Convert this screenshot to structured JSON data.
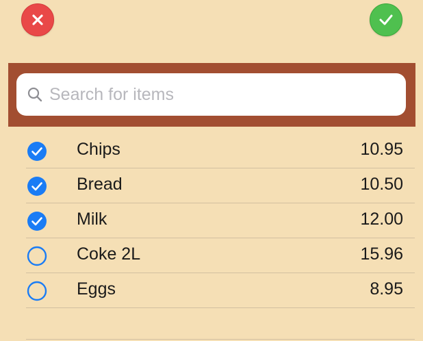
{
  "colors": {
    "background": "#f5dfb5",
    "search_band": "#a24e31",
    "cancel": "#e94848",
    "confirm": "#4fc04f",
    "check_blue": "#1a7cf5"
  },
  "toolbar": {
    "cancel_icon": "close-icon",
    "confirm_icon": "checkmark-icon"
  },
  "search": {
    "placeholder": "Search for items",
    "value": ""
  },
  "items": [
    {
      "name": "Chips",
      "price": "10.95",
      "checked": true
    },
    {
      "name": "Bread",
      "price": "10.50",
      "checked": true
    },
    {
      "name": "Milk",
      "price": "12.00",
      "checked": true
    },
    {
      "name": "Coke 2L",
      "price": "15.96",
      "checked": false
    },
    {
      "name": "Eggs",
      "price": "8.95",
      "checked": false
    }
  ]
}
